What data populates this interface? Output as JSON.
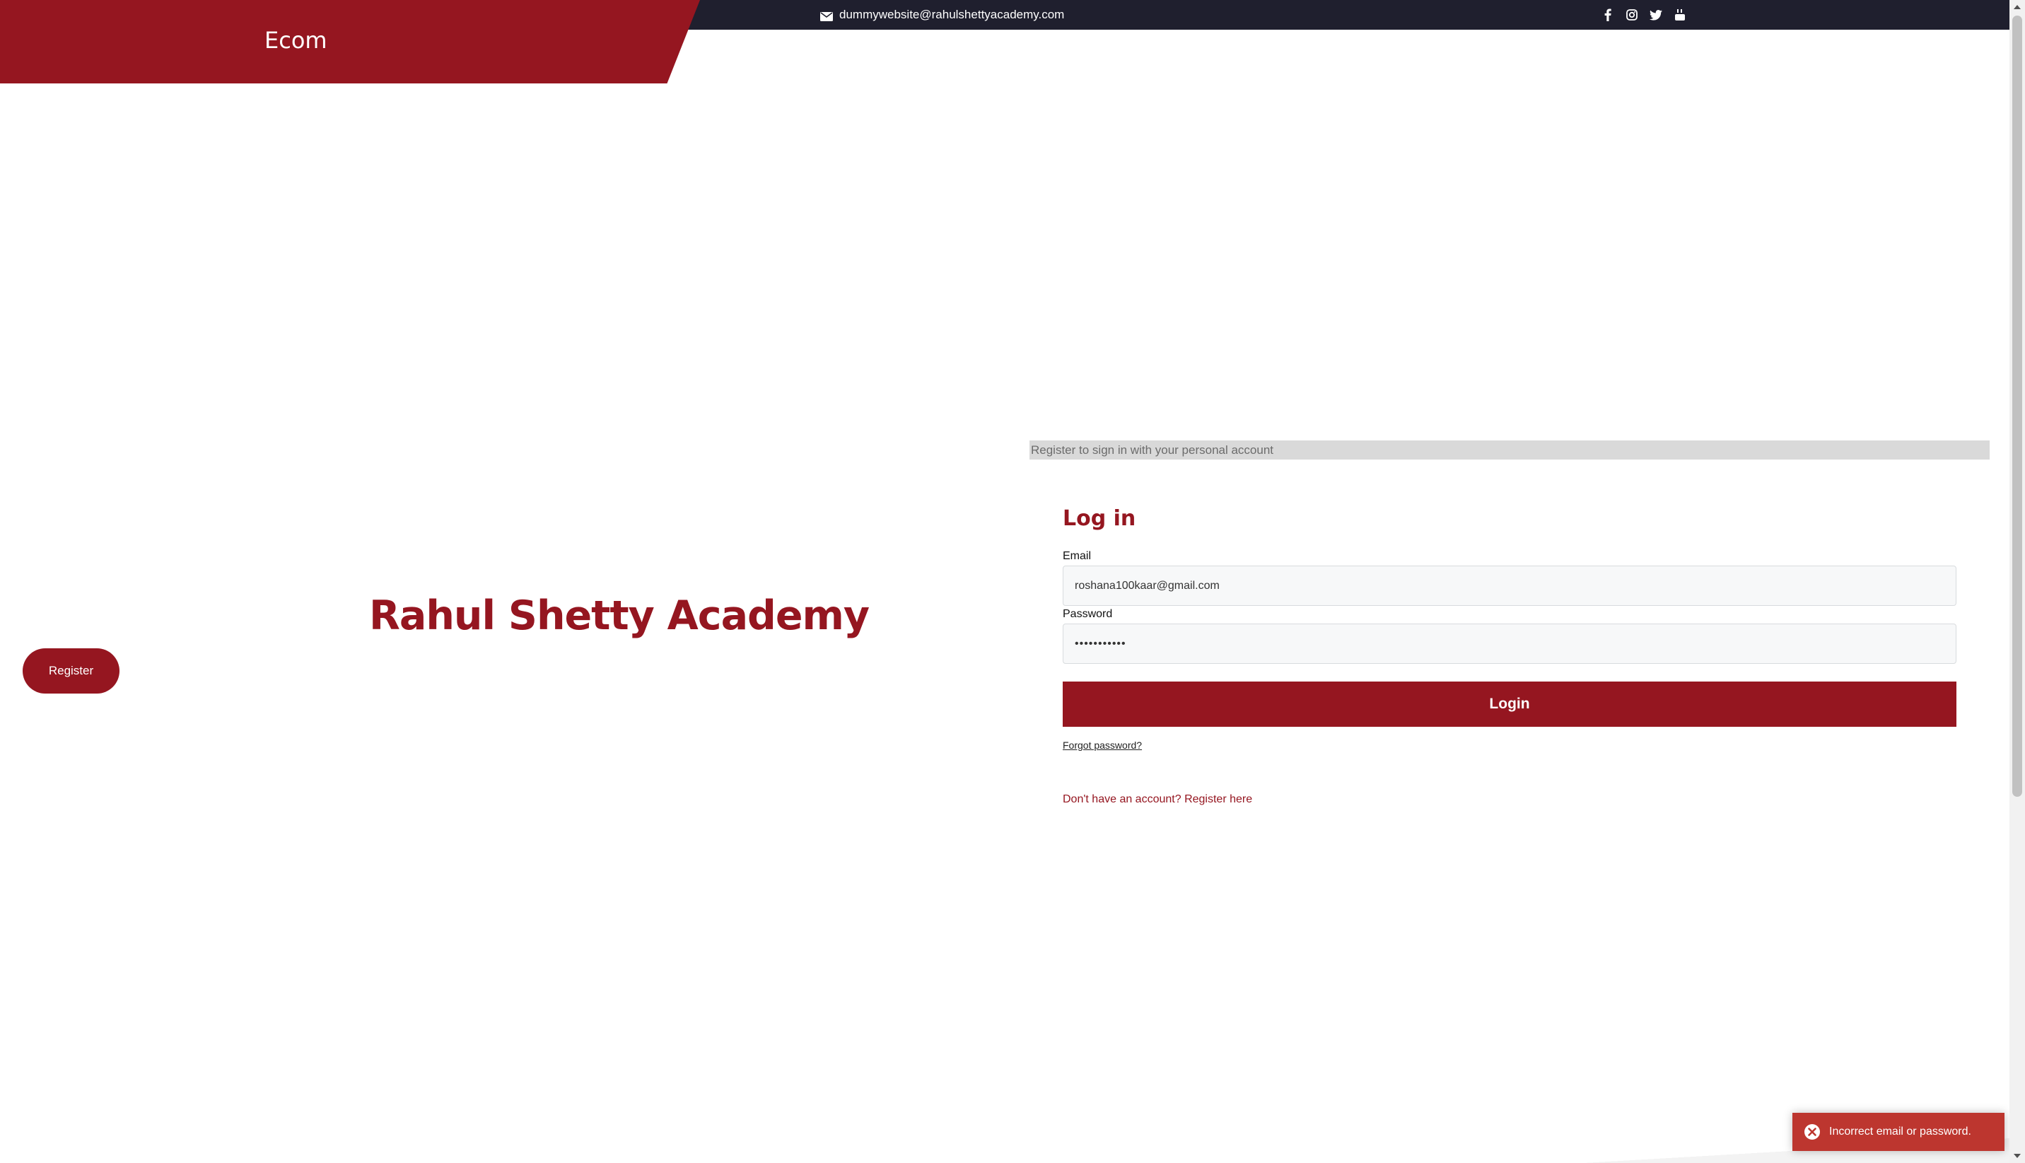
{
  "header": {
    "brand": "Ecom",
    "contact_email": "dummywebsite@rahulshettyacademy.com",
    "social_icons": [
      "facebook-icon",
      "instagram-icon",
      "twitter-icon",
      "youtube-icon"
    ]
  },
  "hero": {
    "title": "Rahul Shetty Academy",
    "register_button": "Register"
  },
  "login": {
    "hint": "Register to sign in with your personal account",
    "heading": "Log in",
    "email_label": "Email",
    "email_value": "roshana100kaar@gmail.com",
    "password_label": "Password",
    "password_value": "•••••••••••",
    "submit_label": "Login",
    "forgot_label": "Forgot password?",
    "register_link": "Don't have an account? Register here"
  },
  "toast": {
    "message": "Incorrect email or password.",
    "icon": "error-circle-icon"
  },
  "colors": {
    "brand_red": "#951620",
    "topbar": "#1f1f2e",
    "toast_bg": "#bd362f"
  }
}
